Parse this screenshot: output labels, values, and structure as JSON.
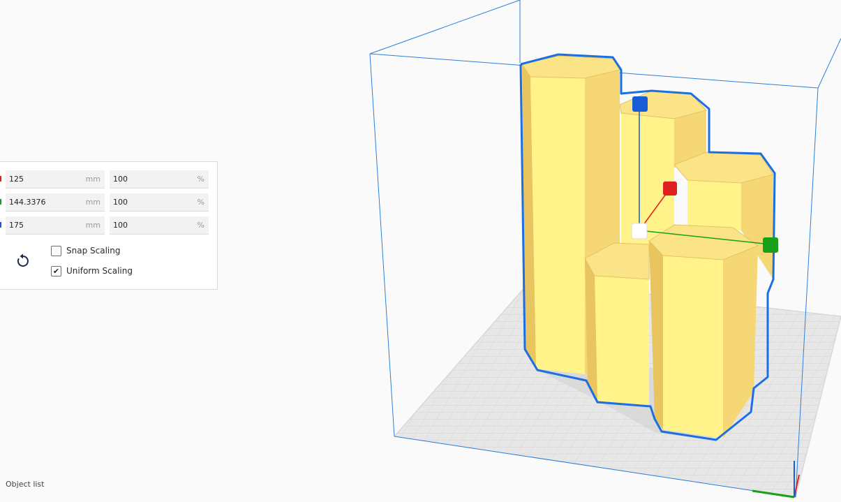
{
  "scale_panel": {
    "x": {
      "value": "125",
      "unit": "mm",
      "percent": "100",
      "percent_unit": "%",
      "axis_color": "#e02020"
    },
    "y": {
      "value": "144.3376",
      "unit": "mm",
      "percent": "100",
      "percent_unit": "%",
      "axis_color": "#18a018"
    },
    "z": {
      "value": "175",
      "unit": "mm",
      "percent": "100",
      "percent_unit": "%",
      "axis_color": "#1a5cd6"
    },
    "snap_scaling": {
      "label": "Snap Scaling",
      "checked": false
    },
    "uniform_scaling": {
      "label": "Uniform Scaling",
      "checked": true,
      "mark": "✔"
    },
    "reset_icon": "reset-rotate-icon"
  },
  "footer": {
    "object_list_label": "Object list"
  },
  "colors": {
    "model_face": "#fff38a",
    "model_side": "#f2d072",
    "selection_outline": "#1b6fe0",
    "build_volume_line": "#2e7fd8",
    "plate": "#e6e6e6",
    "handle_x": "#e02020",
    "handle_y": "#18a018",
    "handle_z": "#1a5cd6"
  }
}
